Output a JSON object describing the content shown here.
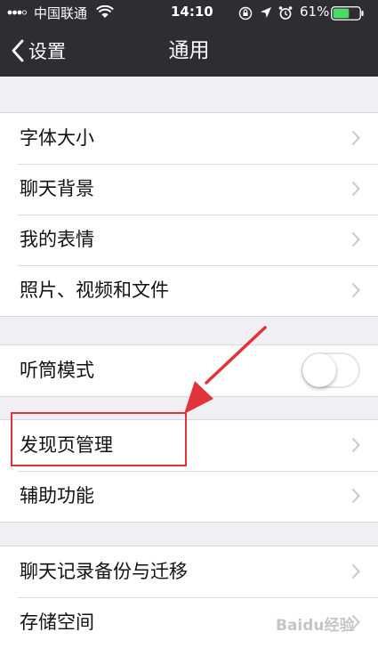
{
  "status_bar": {
    "carrier": "中国联通",
    "time": "14:10",
    "battery_percent": "61%",
    "battery_level": 0.61,
    "icons": [
      "signal-icon",
      "wifi-icon",
      "orientation-lock-icon",
      "location-icon",
      "alarm-icon",
      "battery-icon"
    ]
  },
  "nav": {
    "back_label": "设置",
    "title": "通用"
  },
  "groups": [
    {
      "items": [
        "字体大小",
        "聊天背景",
        "我的表情",
        "照片、视频和文件"
      ]
    },
    {
      "items": [
        "听筒模式"
      ],
      "toggle_on": false
    },
    {
      "items": [
        "发现页管理",
        "辅助功能"
      ]
    },
    {
      "items": [
        "聊天记录备份与迁移",
        "存储空间"
      ]
    }
  ],
  "annotation": {
    "highlighted_item": "发现页管理",
    "color": "#e0333a"
  },
  "watermark": "Baidu经验",
  "colors": {
    "header_bg": "#2e2e32",
    "page_bg": "#efeff4",
    "battery_green": "#4cd964"
  }
}
